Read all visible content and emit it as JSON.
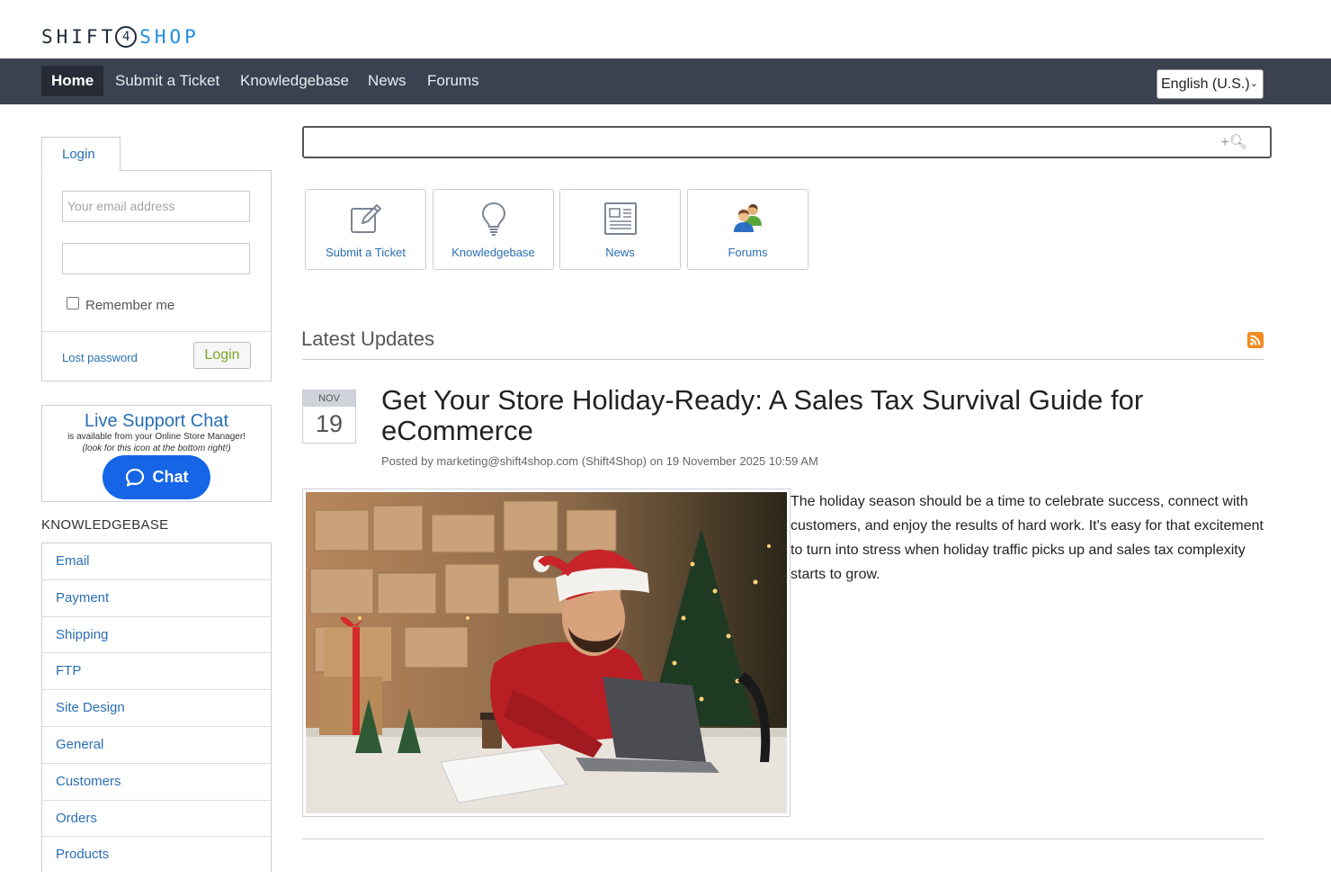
{
  "logo": {
    "part1": "SHIFT",
    "digit": "4",
    "part2": "SHOP"
  },
  "nav": {
    "items": [
      {
        "label": "Home",
        "active": true
      },
      {
        "label": "Submit a Ticket"
      },
      {
        "label": "Knowledgebase"
      },
      {
        "label": "News"
      },
      {
        "label": "Forums"
      }
    ],
    "language": "English (U.S.)"
  },
  "login": {
    "tab_label": "Login",
    "email_placeholder": "Your email address",
    "password_placeholder": "",
    "remember_label": "Remember me",
    "lost_password": "Lost password",
    "button_label": "Login"
  },
  "chat": {
    "title": "Live Support Chat",
    "line1": "is available from your Online Store Manager!",
    "line2": "(look for this icon at the bottom right!)",
    "button_label": "Chat"
  },
  "knowledgebase": {
    "heading": "KNOWLEDGEBASE",
    "items": [
      "Email",
      "Payment",
      "Shipping",
      "FTP",
      "Site Design",
      "General",
      "Customers",
      "Orders",
      "Products"
    ]
  },
  "search": {
    "placeholder": "",
    "icon": "search-icon"
  },
  "tiles": [
    {
      "label": "Submit a Ticket",
      "icon": "edit-icon"
    },
    {
      "label": "Knowledgebase",
      "icon": "lightbulb-icon"
    },
    {
      "label": "News",
      "icon": "newspaper-icon"
    },
    {
      "label": "Forums",
      "icon": "users-icon"
    }
  ],
  "updates": {
    "heading": "Latest Updates",
    "post": {
      "month": "NOV",
      "day": "19",
      "title": "Get Your Store Holiday-Ready: A Sales Tax Survival Guide for eCommerce",
      "meta": "Posted by marketing@shift4shop.com (Shift4Shop) on 19 November 2025 10:59 AM",
      "body": "The holiday season should be a time to celebrate success, connect with customers, and enjoy the results of hard work. It's easy for that excitement to turn into stress when holiday traffic picks up and sales tax complexity starts to grow."
    }
  },
  "colors": {
    "nav_bg": "#3b4150",
    "accent_blue": "#2a6fb4",
    "chat_blue": "#1565e6",
    "rss_orange": "#f28a1e"
  }
}
